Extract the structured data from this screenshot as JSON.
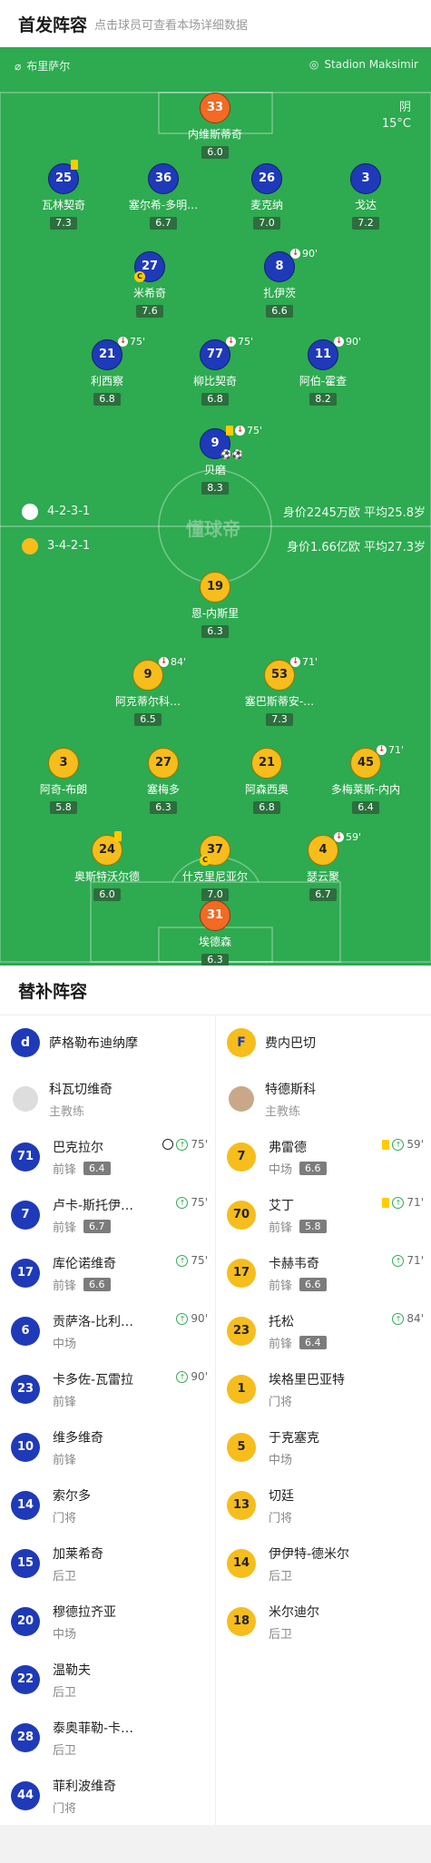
{
  "header": {
    "title": "首发阵容",
    "subtitle": "点击球员可查看本场详细数据"
  },
  "field": {
    "referee": "布里萨尔",
    "stadium": "Stadion Maksimir",
    "weather": "阴",
    "temperature": "15°C",
    "watermark": "懂球帝"
  },
  "home_team": {
    "formation": "4-2-3-1",
    "value": "身价2245万欧",
    "age": "平均25.8岁"
  },
  "away_team": {
    "formation": "3-4-2-1",
    "value": "身价1.66亿欧",
    "age": "平均27.3岁"
  },
  "home_players": [
    {
      "num": "33",
      "name": "内维斯蒂奇",
      "rating": "6.0"
    },
    {
      "num": "25",
      "name": "瓦林契奇",
      "rating": "7.3"
    },
    {
      "num": "36",
      "name": "塞尔希-多明…",
      "rating": "6.7"
    },
    {
      "num": "26",
      "name": "麦克纳",
      "rating": "7.0"
    },
    {
      "num": "3",
      "name": "戈达",
      "rating": "7.2"
    },
    {
      "num": "27",
      "name": "米希奇",
      "rating": "7.6"
    },
    {
      "num": "8",
      "name": "扎伊茨",
      "rating": "6.6",
      "sub": "90'"
    },
    {
      "num": "21",
      "name": "利西察",
      "rating": "6.8",
      "sub": "75'"
    },
    {
      "num": "77",
      "name": "柳比契奇",
      "rating": "6.8",
      "sub": "75'"
    },
    {
      "num": "11",
      "name": "阿伯-霍查",
      "rating": "8.2",
      "sub": "90'"
    },
    {
      "num": "9",
      "name": "贝磨",
      "rating": "8.3",
      "sub": "75'"
    }
  ],
  "away_players": [
    {
      "num": "19",
      "name": "恩-内斯里",
      "rating": "6.3"
    },
    {
      "num": "9",
      "name": "阿克蒂尔科…",
      "rating": "6.5",
      "sub": "84'"
    },
    {
      "num": "53",
      "name": "塞巴斯蒂安-…",
      "rating": "7.3",
      "sub": "71'"
    },
    {
      "num": "3",
      "name": "阿奇-布朗",
      "rating": "5.8"
    },
    {
      "num": "27",
      "name": "塞梅多",
      "rating": "6.3"
    },
    {
      "num": "21",
      "name": "阿森西奥",
      "rating": "6.8"
    },
    {
      "num": "45",
      "name": "多梅莱斯-内内",
      "rating": "6.4",
      "sub": "71'"
    },
    {
      "num": "24",
      "name": "奥斯特沃尔德",
      "rating": "6.0"
    },
    {
      "num": "37",
      "name": "什克里尼亚尔",
      "rating": "7.0"
    },
    {
      "num": "4",
      "name": "瑟云聚",
      "rating": "6.7",
      "sub": "59'"
    },
    {
      "num": "31",
      "name": "埃德森",
      "rating": "6.3"
    }
  ],
  "subs": {
    "title": "替补阵容",
    "home_team": "萨格勒布迪纳摩",
    "away_team": "费内巴切",
    "home_coach": {
      "name": "科瓦切维奇",
      "role": "主教练"
    },
    "away_coach": {
      "name": "特德斯科",
      "role": "主教练"
    },
    "home": [
      {
        "num": "71",
        "name": "巴克拉尔",
        "pos": "前锋",
        "rating": "6.4",
        "time": "75'",
        "goal": true
      },
      {
        "num": "7",
        "name": "卢卡-斯托伊…",
        "pos": "前锋",
        "rating": "6.7",
        "time": "75'"
      },
      {
        "num": "17",
        "name": "库伦诺维奇",
        "pos": "前锋",
        "rating": "6.6",
        "time": "75'"
      },
      {
        "num": "6",
        "name": "贡萨洛-比利…",
        "pos": "中场",
        "rating": "",
        "time": "90'"
      },
      {
        "num": "23",
        "name": "卡多佐-瓦雷拉",
        "pos": "前锋",
        "rating": "",
        "time": "90'"
      },
      {
        "num": "10",
        "name": "维多维奇",
        "pos": "前锋",
        "rating": "",
        "time": ""
      },
      {
        "num": "14",
        "name": "索尔多",
        "pos": "门将",
        "rating": "",
        "time": ""
      },
      {
        "num": "15",
        "name": "加莱希奇",
        "pos": "后卫",
        "rating": "",
        "time": ""
      },
      {
        "num": "20",
        "name": "穆德拉齐亚",
        "pos": "中场",
        "rating": "",
        "time": ""
      },
      {
        "num": "22",
        "name": "温勒夫",
        "pos": "后卫",
        "rating": "",
        "time": ""
      },
      {
        "num": "28",
        "name": "泰奥菲勒-卡…",
        "pos": "后卫",
        "rating": "",
        "time": ""
      },
      {
        "num": "44",
        "name": "菲利波维奇",
        "pos": "门将",
        "rating": "",
        "time": ""
      }
    ],
    "away": [
      {
        "num": "7",
        "name": "弗雷德",
        "pos": "中场",
        "rating": "6.6",
        "time": "59'",
        "yellow": true
      },
      {
        "num": "70",
        "name": "艾丁",
        "pos": "前锋",
        "rating": "5.8",
        "time": "71'",
        "yellow": true
      },
      {
        "num": "17",
        "name": "卡赫韦奇",
        "pos": "前锋",
        "rating": "6.6",
        "time": "71'"
      },
      {
        "num": "23",
        "name": "托松",
        "pos": "前锋",
        "rating": "6.4",
        "time": "84'"
      },
      {
        "num": "1",
        "name": "埃格里巴亚特",
        "pos": "门将",
        "rating": "",
        "time": ""
      },
      {
        "num": "5",
        "name": "于克塞克",
        "pos": "中场",
        "rating": "",
        "time": ""
      },
      {
        "num": "13",
        "name": "切廷",
        "pos": "门将",
        "rating": "",
        "time": ""
      },
      {
        "num": "14",
        "name": "伊伊特-德米尔",
        "pos": "后卫",
        "rating": "",
        "time": ""
      },
      {
        "num": "18",
        "name": "米尔迪尔",
        "pos": "后卫",
        "rating": "",
        "time": ""
      }
    ]
  }
}
